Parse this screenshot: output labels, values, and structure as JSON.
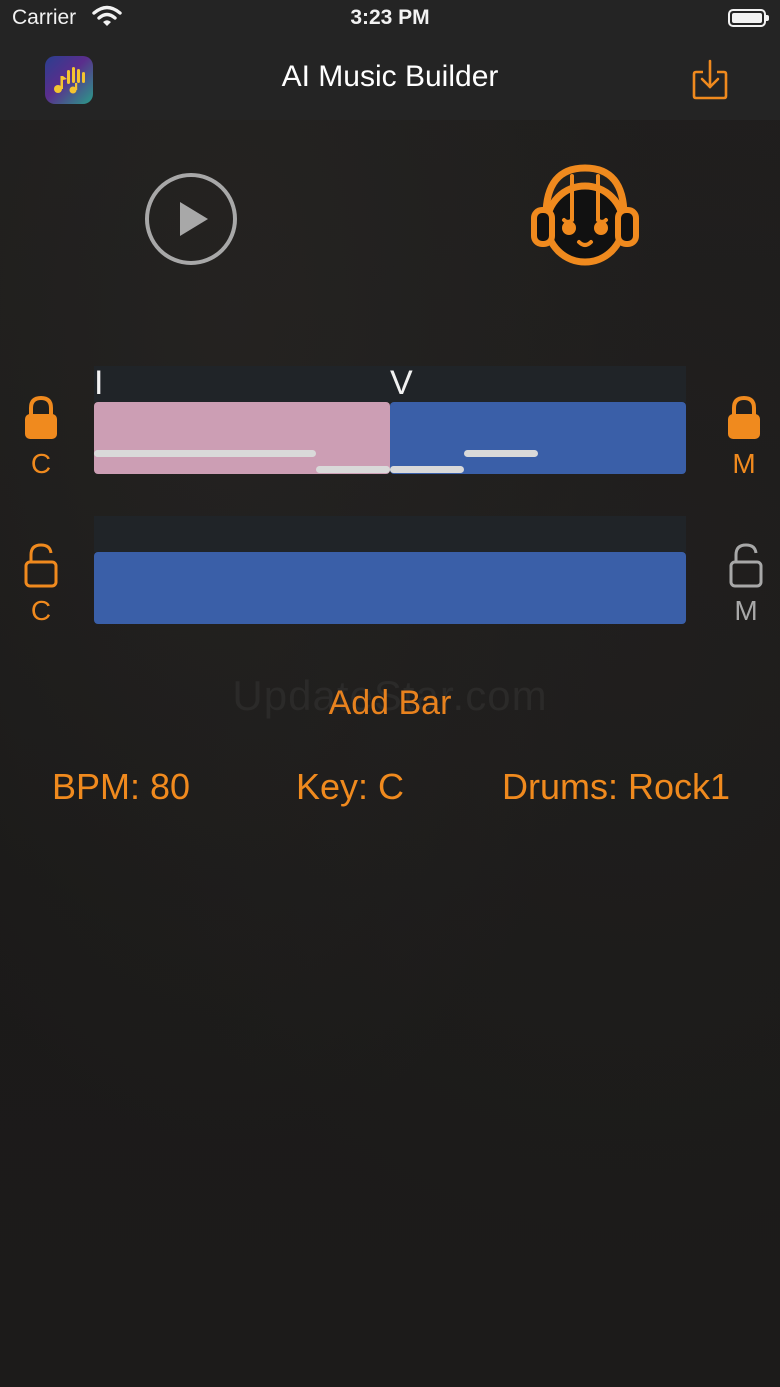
{
  "status_bar": {
    "carrier": "Carrier",
    "time": "3:23 PM"
  },
  "nav": {
    "title": "AI Music Builder",
    "logo_icon": "app-logo-music-hand",
    "download_icon": "download-icon"
  },
  "controls": {
    "play_icon": "play-icon",
    "dj_icon": "dj-headphones-robot-icon"
  },
  "tracks": [
    {
      "left_control": {
        "icon": "lock-closed-icon",
        "label": "C"
      },
      "right_control": {
        "icon": "lock-closed-icon",
        "label": "M"
      },
      "chords": [
        "I",
        "V"
      ],
      "bar_colors": [
        "#cc9eb4",
        "#3a5fa8"
      ]
    },
    {
      "left_control": {
        "icon": "lock-open-icon",
        "label": "C"
      },
      "right_control": {
        "icon": "lock-open-icon",
        "label": "M"
      },
      "chords": [],
      "bar_colors": [
        "#3a5fa8"
      ]
    }
  ],
  "actions": {
    "add_bar": "Add Bar"
  },
  "settings": {
    "bpm": "BPM: 80",
    "key": "Key: C",
    "drums": "Drums: Rock1"
  },
  "watermark": "UpdateStar.com",
  "colors": {
    "accent": "#f08a1e",
    "header_bg": "#242424",
    "bar_blue": "#3a5fa8",
    "bar_pink": "#cc9eb4",
    "muted_icon": "#a8a8a8"
  }
}
